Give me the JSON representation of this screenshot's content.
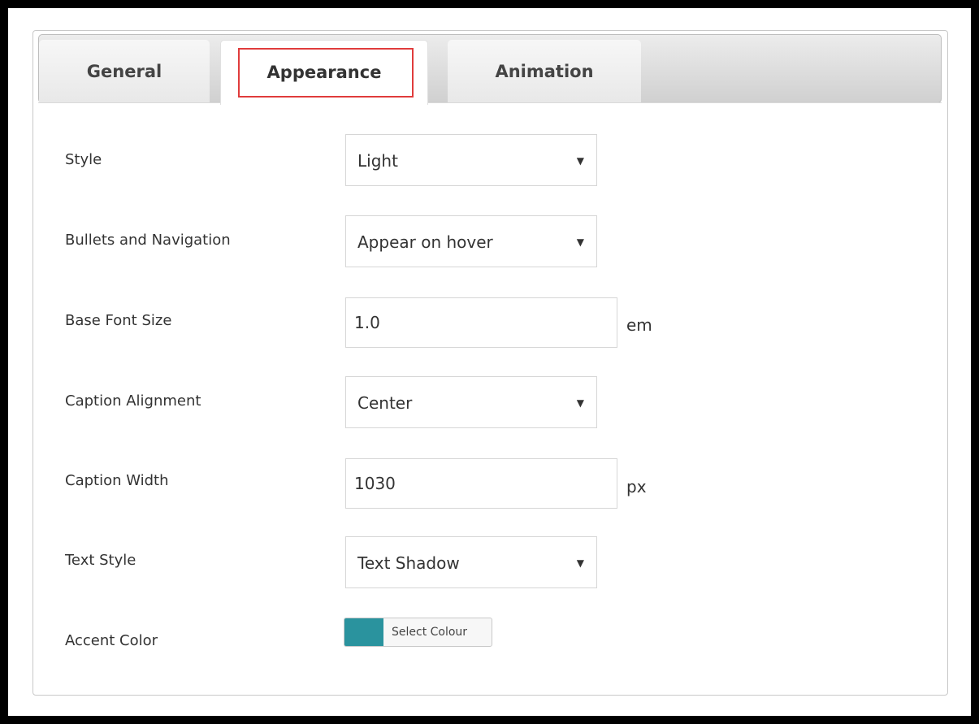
{
  "tabs": {
    "general": "General",
    "appearance": "Appearance",
    "animation": "Animation"
  },
  "form": {
    "style": {
      "label": "Style",
      "value": "Light"
    },
    "bullets": {
      "label": "Bullets and Navigation",
      "value": "Appear on hover"
    },
    "base_font_size": {
      "label": "Base Font Size",
      "value": "1.0",
      "unit": "em"
    },
    "caption_alignment": {
      "label": "Caption Alignment",
      "value": "Center"
    },
    "caption_width": {
      "label": "Caption Width",
      "value": "1030",
      "unit": "px"
    },
    "text_style": {
      "label": "Text Style",
      "value": "Text Shadow"
    },
    "accent_color": {
      "label": "Accent Color",
      "button_label": "Select Colour",
      "color": "#2a939e"
    }
  },
  "caret_glyph": "▼",
  "colors": {
    "highlight": "#e03c3c",
    "accent": "#2a939e"
  }
}
